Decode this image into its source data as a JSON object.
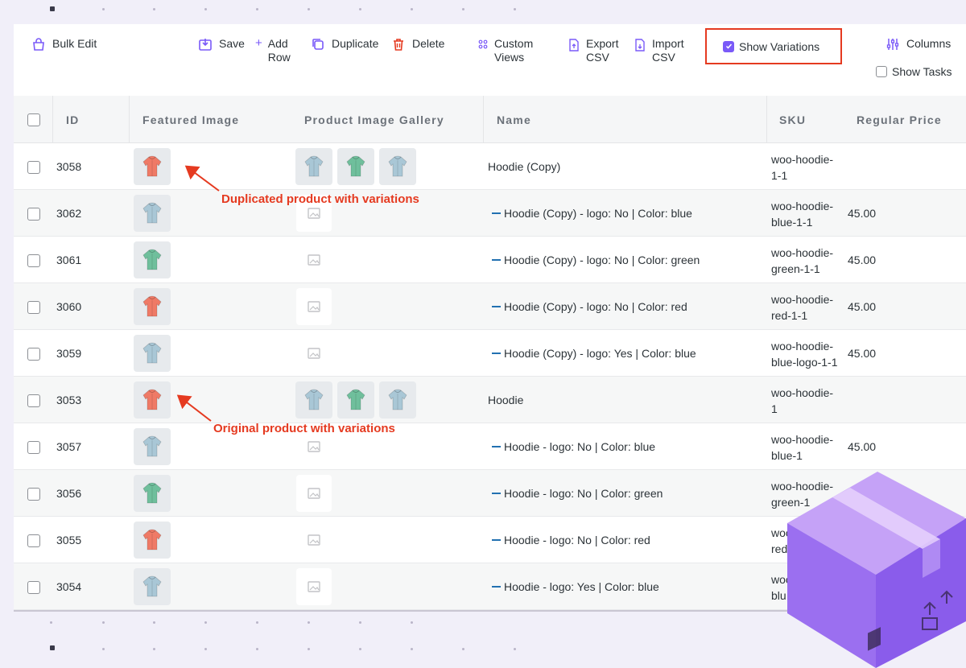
{
  "toolbar": {
    "bulk_edit": "Bulk Edit",
    "save": "Save",
    "add_row": "Add\nRow",
    "duplicate": "Duplicate",
    "delete": "Delete",
    "custom_views": "Custom\nViews",
    "export_csv": "Export\nCSV",
    "import_csv": "Import\nCSV",
    "show_variations": "Show Variations",
    "columns": "Columns",
    "show_tasks": "Show Tasks"
  },
  "table": {
    "columns": [
      "ID",
      "Featured Image",
      "Product Image Gallery",
      "Name",
      "SKU",
      "Regular Price"
    ],
    "rows": [
      {
        "id": "3058",
        "name": "Hoodie (Copy)",
        "variation": false,
        "sku": "woo-hoodie-\n1-1",
        "price": "",
        "thumb": "red",
        "gallery": true
      },
      {
        "id": "3062",
        "name": "Hoodie (Copy) - logo: No | Color: blue",
        "variation": true,
        "sku": "woo-hoodie-\nblue-1-1",
        "price": "45.00",
        "thumb": "blue",
        "gallery": false
      },
      {
        "id": "3061",
        "name": "Hoodie (Copy) - logo: No | Color: green",
        "variation": true,
        "sku": "woo-hoodie-\ngreen-1-1",
        "price": "45.00",
        "thumb": "green",
        "gallery": false
      },
      {
        "id": "3060",
        "name": "Hoodie (Copy) - logo: No | Color: red",
        "variation": true,
        "sku": "woo-hoodie-\nred-1-1",
        "price": "45.00",
        "thumb": "red",
        "gallery": false
      },
      {
        "id": "3059",
        "name": "Hoodie (Copy) - logo: Yes | Color: blue",
        "variation": true,
        "sku": "woo-hoodie-\nblue-logo-1-1",
        "price": "45.00",
        "thumb": "blue",
        "gallery": false
      },
      {
        "id": "3053",
        "name": "Hoodie",
        "variation": false,
        "sku": "woo-hoodie-\n1",
        "price": "",
        "thumb": "red",
        "gallery": true
      },
      {
        "id": "3057",
        "name": "Hoodie - logo: No | Color: blue",
        "variation": true,
        "sku": "woo-hoodie-\nblue-1",
        "price": "45.00",
        "thumb": "blue",
        "gallery": false
      },
      {
        "id": "3056",
        "name": "Hoodie - logo: No | Color: green",
        "variation": true,
        "sku": "woo-hoodie-\ngreen-1",
        "price": "",
        "thumb": "green",
        "gallery": false
      },
      {
        "id": "3055",
        "name": "Hoodie - logo: No | Color: red",
        "variation": true,
        "sku": "woo\nred",
        "price": "",
        "thumb": "red",
        "gallery": false
      },
      {
        "id": "3054",
        "name": "Hoodie - logo: Yes | Color: blue",
        "variation": true,
        "sku": "woo\nblu",
        "price": "",
        "thumb": "blue",
        "gallery": false
      }
    ]
  },
  "annotations": {
    "duplicated": "Duplicated product with variations",
    "original": "Original product with variations"
  },
  "colors": {
    "accent": "#7a5af8",
    "annotation": "#e53a20",
    "hoodie_red": "#ef7a66",
    "hoodie_blue": "#a9c7d6",
    "hoodie_green": "#6fbf9c"
  }
}
